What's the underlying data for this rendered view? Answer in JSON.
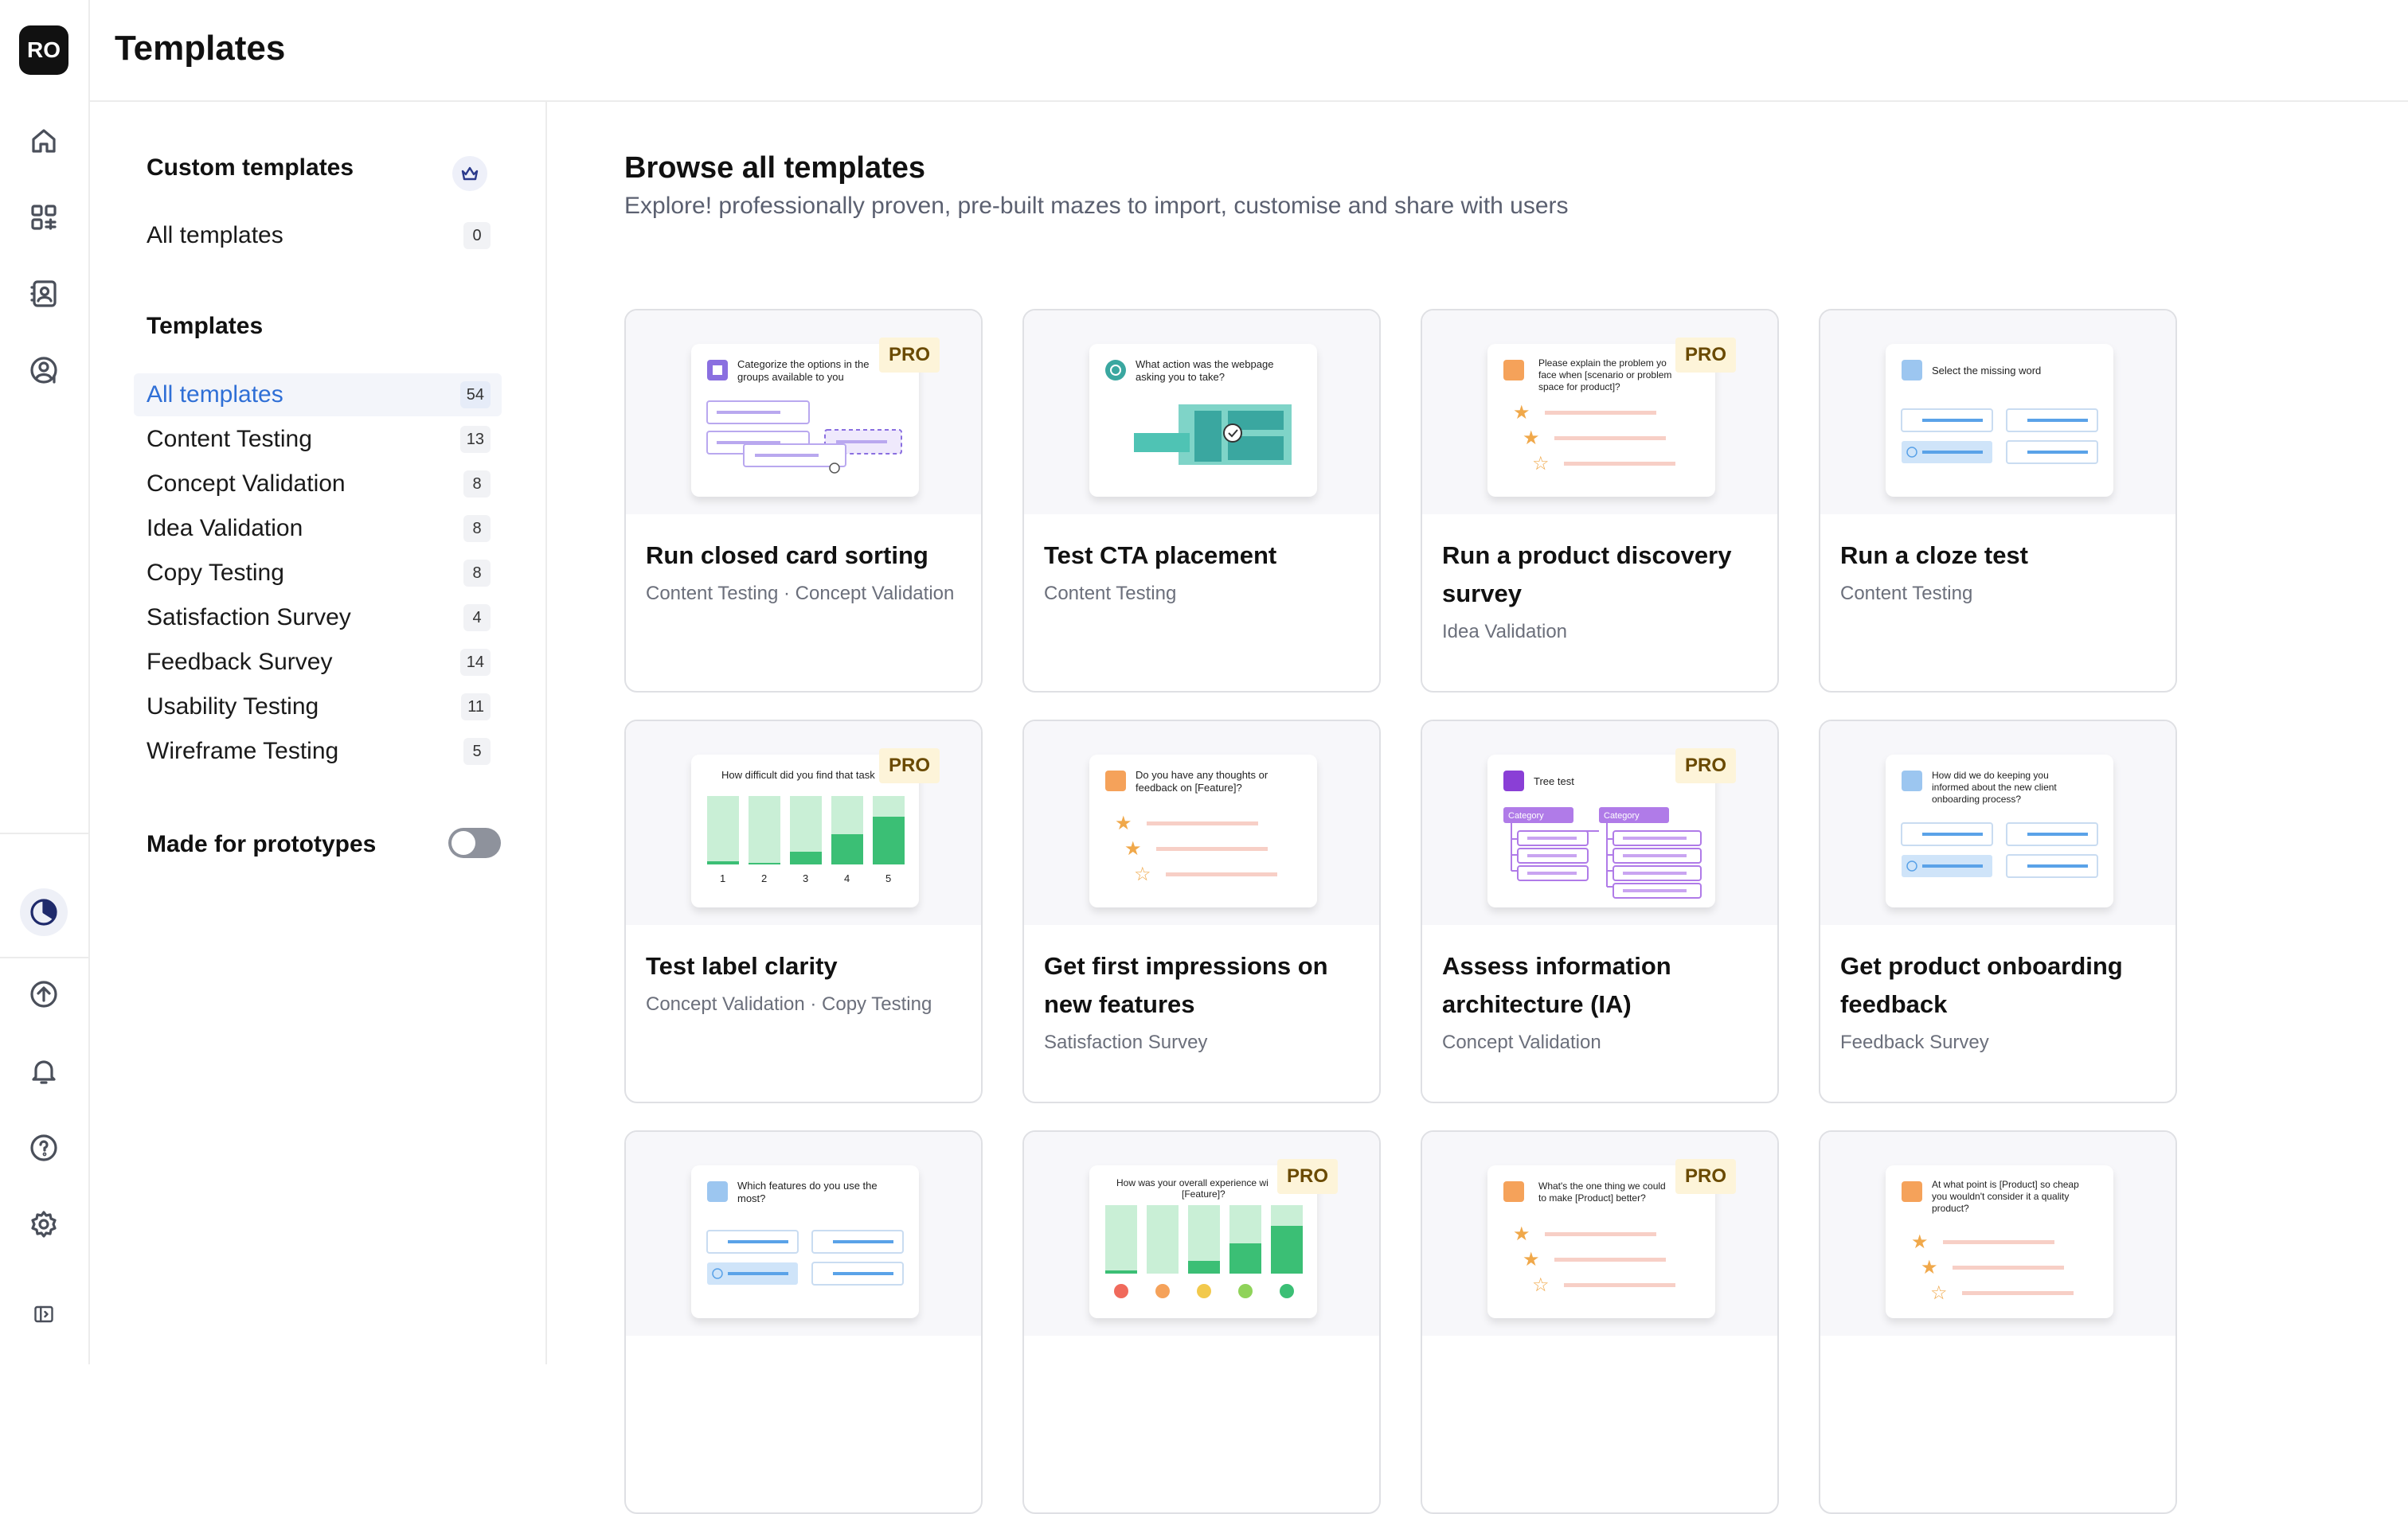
{
  "app": {
    "logo_text": "RO"
  },
  "header": {
    "title": "Templates"
  },
  "rail": {
    "items": [
      "home-icon",
      "apps-icon",
      "contacts-icon",
      "user-money-icon",
      "clock-chart-icon",
      "upload-icon",
      "bell-icon",
      "help-icon",
      "gear-icon",
      "sidebar-toggle-icon"
    ],
    "active": "clock-chart-icon"
  },
  "panel": {
    "custom_title": "Custom templates",
    "custom_items": [
      {
        "label": "All templates",
        "count": "0"
      }
    ],
    "templates_title": "Templates",
    "items": [
      {
        "label": "All templates",
        "count": "54"
      },
      {
        "label": "Content Testing",
        "count": "13"
      },
      {
        "label": "Concept Validation",
        "count": "8"
      },
      {
        "label": "Idea Validation",
        "count": "8"
      },
      {
        "label": "Copy Testing",
        "count": "8"
      },
      {
        "label": "Satisfaction Survey",
        "count": "4"
      },
      {
        "label": "Feedback Survey",
        "count": "14"
      },
      {
        "label": "Usability Testing",
        "count": "11"
      },
      {
        "label": "Wireframe Testing",
        "count": "5"
      }
    ],
    "prototypes_label": "Made for prototypes",
    "prototypes_on": false
  },
  "main": {
    "title": "Browse all templates",
    "subtitle": "Explore! professionally proven, pre-built mazes to import, customise and share with users",
    "pro_label": "PRO",
    "cards": [
      {
        "title": "Run closed card sorting",
        "tags": "Content Testing · Concept Validation",
        "pro": true,
        "thumb_text": [
          "Categorize the options in the",
          "groups available to you"
        ]
      },
      {
        "title": "Test CTA placement",
        "tags": "Content Testing",
        "pro": false,
        "thumb_text": [
          "What action was the webpage",
          "asking you to take?"
        ]
      },
      {
        "title": "Run a product discovery survey",
        "tags": "Idea Validation",
        "pro": true,
        "thumb_text": [
          "Please explain the problem yo",
          "face when [scenario or problem",
          "space for product]?"
        ]
      },
      {
        "title": "Run a cloze test",
        "tags": "Content Testing",
        "pro": false,
        "thumb_text": [
          "Select the missing word"
        ]
      },
      {
        "title": "Test label clarity",
        "tags": "Concept Validation · Copy Testing",
        "pro": true,
        "thumb_text": [
          "How difficult did you find that task"
        ],
        "axis": [
          "1",
          "2",
          "3",
          "4",
          "5"
        ]
      },
      {
        "title": "Get first impressions on new features",
        "tags": "Satisfaction Survey",
        "pro": false,
        "thumb_text": [
          "Do you have any thoughts or",
          "feedback on [Feature]?"
        ]
      },
      {
        "title": "Assess information architecture (IA)",
        "tags": "Concept Validation",
        "pro": true,
        "thumb_text": [
          "Tree test"
        ],
        "categories": [
          "Category",
          "Category"
        ]
      },
      {
        "title": "Get product onboarding feedback",
        "tags": "Feedback Survey",
        "pro": false,
        "thumb_text": [
          "How did we do keeping you",
          "informed about the new client",
          "onboarding process?"
        ]
      },
      {
        "title": "",
        "tags": "",
        "pro": false,
        "thumb_text": [
          "Which features do you use the",
          "most?"
        ]
      },
      {
        "title": "",
        "tags": "",
        "pro": true,
        "thumb_text": [
          "How was your overall experience wi",
          "[Feature]?"
        ]
      },
      {
        "title": "",
        "tags": "",
        "pro": true,
        "thumb_text": [
          "What's the one thing we could",
          "to make [Product] better?"
        ]
      },
      {
        "title": "",
        "tags": "",
        "pro": false,
        "thumb_text": [
          "At what point is [Product] so cheap",
          "you wouldn't consider it a quality",
          "product?"
        ]
      }
    ]
  },
  "colors": {
    "accent_blue": "#2f6fd6",
    "pro_bg": "#fdf4d9",
    "pro_text": "#6a4a00",
    "green": "#3bbf75",
    "teal": "#4fc3b4",
    "purple": "#9b5fe0",
    "star": "#f0a84a"
  }
}
